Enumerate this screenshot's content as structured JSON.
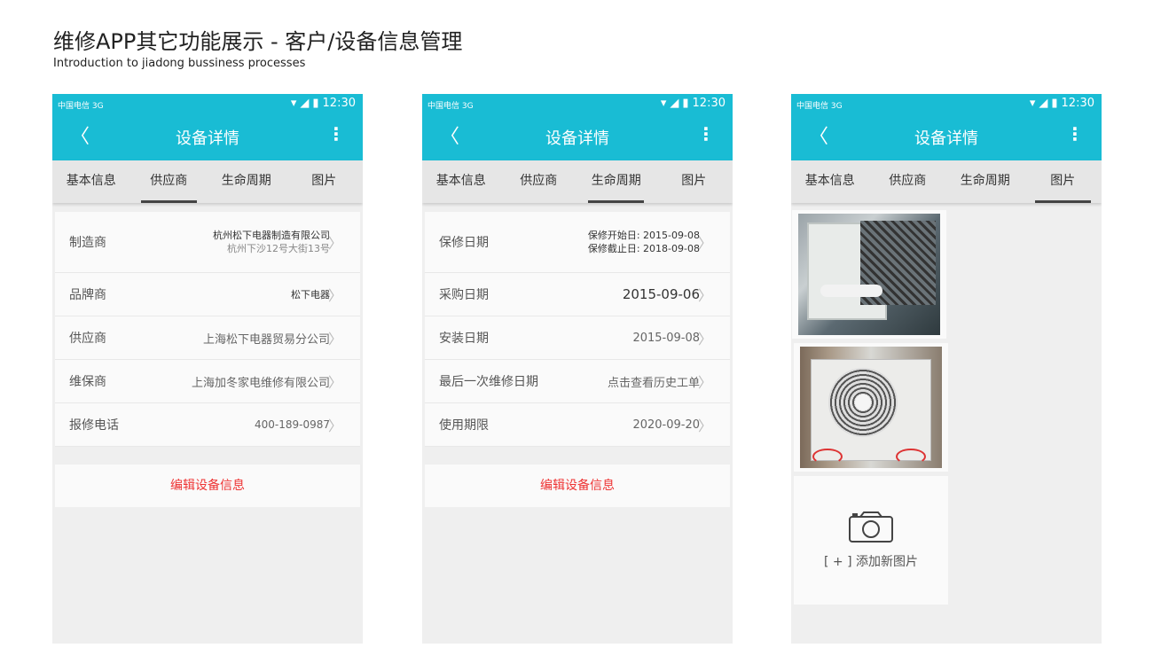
{
  "heading": {
    "title": "维修APP其它功能展示 - 客户/设备信息管理",
    "subtitle": "Introduction to jiadong bussiness processes"
  },
  "status": {
    "carrier": "中国电信 3G",
    "time": "12:30"
  },
  "appbar": {
    "back": "〈",
    "title": "设备详情",
    "more": "⋮"
  },
  "tabs": [
    "基本信息",
    "供应商",
    "生命周期",
    "图片"
  ],
  "chev": "〉",
  "screen1": {
    "rows": [
      {
        "label": "制造商",
        "value": "杭州松下电器制造有限公司",
        "sub": "杭州下沙12号大街13号"
      },
      {
        "label": "品牌商",
        "value": "松下电器"
      },
      {
        "label": "供应商",
        "value": "上海松下电器贸易分公司"
      },
      {
        "label": "维保商",
        "value": "上海加冬家电维修有限公司"
      },
      {
        "label": "报修电话",
        "value": "400-189-0987"
      }
    ],
    "edit": "编辑设备信息"
  },
  "screen2": {
    "rows": [
      {
        "label": "保修日期",
        "value": "保修开始日: 2015-09-08",
        "sub": "保修截止日: 2018-09-08"
      },
      {
        "label": "采购日期",
        "value": "2015-09-06"
      },
      {
        "label": "安装日期",
        "value": "2015-09-08"
      },
      {
        "label": "最后一次维修日期",
        "value": "点击查看历史工单"
      },
      {
        "label": "使用期限",
        "value": "2020-09-20"
      }
    ],
    "edit": "编辑设备信息"
  },
  "screen3": {
    "add_label": "[ + ] 添加新图片",
    "camera_icon": "camera-icon"
  },
  "colors": {
    "appbar": "#19bcd4",
    "edit_text": "#ee3333"
  }
}
